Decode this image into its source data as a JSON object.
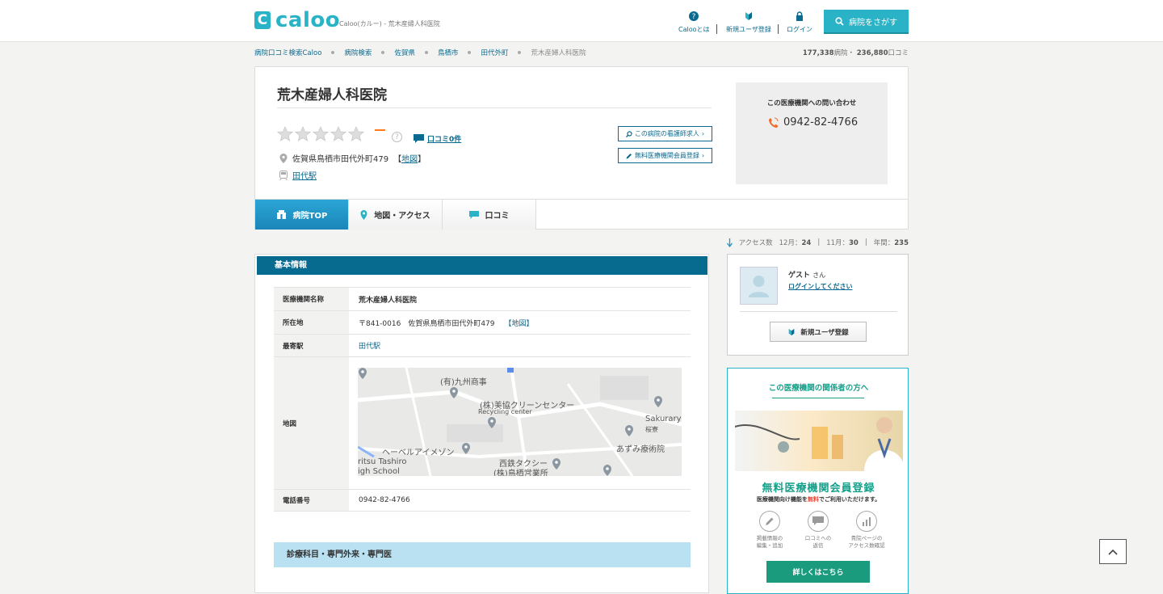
{
  "header": {
    "logo_mark": "C",
    "logo_text": "caloo",
    "logo_sub": "Caloo(カルー) - 荒木産婦人科医院",
    "nav": [
      {
        "label": "Calooとは",
        "icon": "question-icon"
      },
      {
        "label": "新規ユーザ登録",
        "icon": "beginner-icon"
      },
      {
        "label": "ログイン",
        "icon": "lock-icon"
      }
    ],
    "search_label": "病院をさがす"
  },
  "breadcrumb": {
    "items": [
      "病院口コミ検索Caloo",
      "病院検索",
      "佐賀県",
      "鳥栖市",
      "田代外町"
    ],
    "current": "荒木産婦人科医院"
  },
  "counts": {
    "hospitals": "177,338",
    "hospitals_unit": "病院・",
    "reviews": "236,880",
    "reviews_unit": "口コミ"
  },
  "hospital": {
    "name": "荒木産婦人科医院",
    "rating": 0,
    "rating_text": "—",
    "review_link": "口コミ0件",
    "address": "佐賀県鳥栖市田代外町479",
    "address_map": "地図",
    "station": "田代駅",
    "btn_nurse": "この病院の看護師求人",
    "btn_member": "無料医療機関会員登録"
  },
  "contact": {
    "title": "この医療機関への問い合わせ",
    "phone": "0942-82-4766"
  },
  "tabs": [
    {
      "label": "病院TOP",
      "icon": "hospital-icon",
      "active": true
    },
    {
      "label": "地図・アクセス",
      "icon": "map-pin-icon",
      "active": false
    },
    {
      "label": "口コミ",
      "icon": "speech-bubble-icon",
      "active": false
    }
  ],
  "access": {
    "label": "アクセス数",
    "m12_label": "12月：",
    "m12": "24",
    "m11_label": "11月：",
    "m11": "30",
    "year_label": "年間：",
    "year": "235"
  },
  "basic_info": {
    "title": "基本情報",
    "rows": [
      {
        "label": "医療機関名称",
        "value": "荒木産婦人科医院"
      },
      {
        "label": "所在地",
        "value": "〒841-0016　佐賀県鳥栖市田代外町479",
        "link": "【地図】"
      },
      {
        "label": "最寄駅",
        "value": "田代駅"
      },
      {
        "label": "地図",
        "value": ""
      },
      {
        "label": "電話番号",
        "value": "0942-82-4766"
      }
    ],
    "map_labels": [
      "(有)九州商事",
      "(株)美協クリーンセンター",
      "Recycling center",
      "Sakuraryo",
      "桜寮",
      "あずみ療術院",
      "ヘーベルアイメゾン",
      "ritsu Tashiro",
      "igh School",
      "西鉄タクシー",
      "(株)鳥栖営業所"
    ],
    "section2": "診療科目・専門外来・専門医"
  },
  "guest": {
    "name": "ゲスト",
    "suffix": "さん",
    "login": "ログインしてください",
    "register": "新規ユーザ登録"
  },
  "promo": {
    "title": "この医療機関の関係者の方へ",
    "main": "無料医療機関会員登録",
    "sub_pre": "医療機関向け機能を",
    "sub_em": "無料",
    "sub_post": "でご利用いただけます。",
    "features": [
      {
        "line1": "掲載情報の",
        "line2": "編集・追加"
      },
      {
        "line1": "口コミへの",
        "line2": "返信"
      },
      {
        "line1": "貴院ページの",
        "line2": "アクセス数確認"
      }
    ],
    "button": "詳しくはこちら"
  },
  "colors": {
    "accent": "#2ab3c7",
    "navy": "#066b8f",
    "link": "#0b6a8f",
    "green": "#17a08a",
    "orange": "#ff7a1a"
  }
}
